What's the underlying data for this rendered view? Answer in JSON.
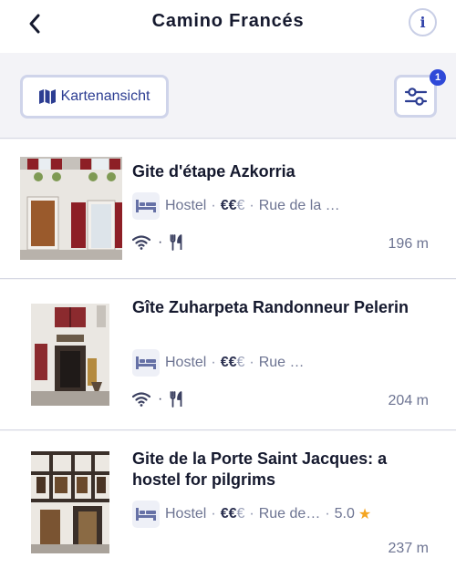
{
  "header": {
    "title": "Camino Francés",
    "info_label": "i"
  },
  "toolbar": {
    "map_button_label": "Kartenansicht",
    "filter_badge_count": "1"
  },
  "listings": [
    {
      "name": "Gite d'étape Azkorria",
      "type": "Hostel",
      "price_bold": "€€",
      "price_dim": "€",
      "address": "Rue de la …",
      "amenities": [
        "wifi-icon",
        "restaurant-icon"
      ],
      "distance": "196 m"
    },
    {
      "name": "Gîte Zuharpeta Randonneur Pelerin",
      "type": "Hostel",
      "price_bold": "€€",
      "price_dim": "€",
      "address": "Rue …",
      "amenities": [
        "wifi-icon",
        "restaurant-icon"
      ],
      "distance": "204 m"
    },
    {
      "name": "Gite de la Porte Saint Jacques: a hostel for pilgrims",
      "type": "Hostel",
      "price_bold": "€€",
      "price_dim": "€",
      "address": "Rue de…",
      "rating": "5.0",
      "distance": "237 m"
    }
  ],
  "colors": {
    "accent": "#2c3d92",
    "badge": "#2f49d8",
    "star": "#f4a521"
  }
}
